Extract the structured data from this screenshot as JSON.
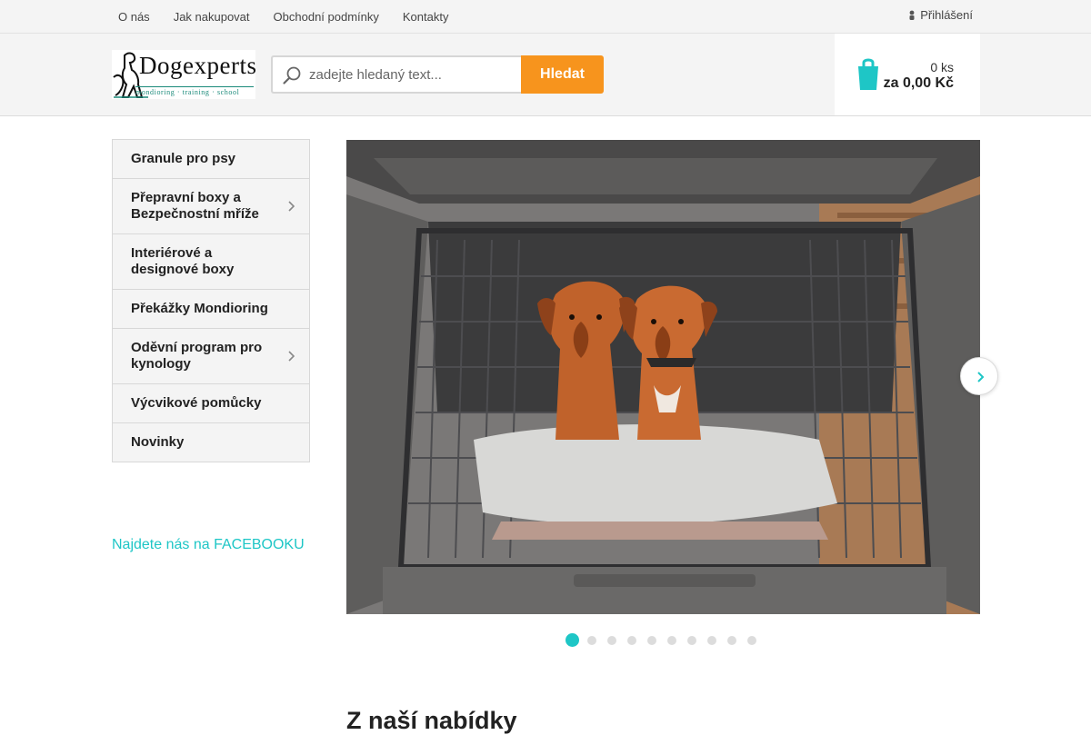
{
  "topnav": {
    "links": [
      "O nás",
      "Jak nakupovat",
      "Obchodní podmínky",
      "Kontakty"
    ],
    "login_label": "Přihlášení"
  },
  "header": {
    "logo_text": "Dogexperts",
    "logo_subtitle": "mondioring · training · school"
  },
  "search": {
    "placeholder": "zadejte hledaný text...",
    "button_label": "Hledat"
  },
  "cart": {
    "count": "0 ks",
    "total": "za 0,00 Kč"
  },
  "sidebar": {
    "categories": [
      {
        "label": "Granule pro psy"
      },
      {
        "label": "Přepravní boxy a Bezpečnostní mříže"
      },
      {
        "label": "Interiérové a designové boxy"
      },
      {
        "label": "Překážky Mondioring"
      },
      {
        "label": "Oděvní program pro kynology"
      },
      {
        "label": "Výcvikové pomůcky"
      },
      {
        "label": "Novinky"
      }
    ],
    "facebook_link": "Najdete nás na FACEBOOKU"
  },
  "slider": {
    "slides_total": 10,
    "active_slide": 1
  },
  "main": {
    "section_title": "Z naší nabídky"
  },
  "colors": {
    "accent": "#1ec6c6",
    "search_button": "#f7941d",
    "topbar_bg": "#f4f4f4"
  }
}
